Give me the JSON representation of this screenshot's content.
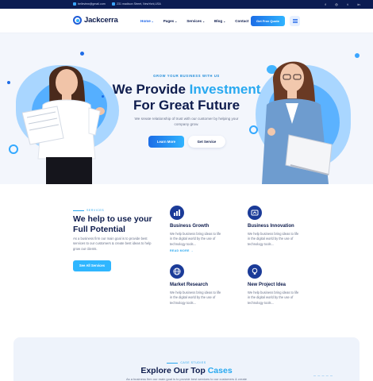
{
  "topbar": {
    "email": "belleview@gmail.com",
    "address": "231 madison Street, NewYork,USA",
    "socials": [
      "f",
      "◎",
      "t",
      "in"
    ],
    "social_icons": [
      "facebook-icon",
      "instagram-icon",
      "twitter-icon",
      "linkedin-icon"
    ]
  },
  "header": {
    "brand": "Jackcerra",
    "nav": [
      {
        "label": "Home",
        "caret": "⌄"
      },
      {
        "label": "Pages",
        "caret": "⌄"
      },
      {
        "label": "Services",
        "caret": "⌄"
      },
      {
        "label": "Blog",
        "caret": "⌄"
      },
      {
        "label": "Contact",
        "caret": ""
      }
    ],
    "cta": "Get Free Quote"
  },
  "hero": {
    "eyebrow": "GROW YOUR BUSINESS WITH US",
    "title_line1_prefix": "We Provide ",
    "title_line1_highlight": "Investment",
    "title_line2": "For Great Future",
    "subtitle": "We sreate relationship of trust with our customer by helping your company grow.",
    "learn_more": "Learn More",
    "get_service": "Get Service"
  },
  "services": {
    "eyebrow": "SERVICES",
    "title_line1": "We help to use your",
    "title_line2": "Full Potential",
    "description": "As a business firm our main goal is to provide best services to our customers & create best ideas to help grow our clients.",
    "button": "See All Services",
    "cards": [
      {
        "title": "Business Growth",
        "desc": "We help business bring ideas to life in the digital world by the use of technology tools...",
        "read_more": "READ MORE →",
        "icon": "chart-icon"
      },
      {
        "title": "Business Innovation",
        "desc": "We help business bring ideas to life in the digital world by the use of technology tools...",
        "read_more": "",
        "icon": "innovation-icon"
      },
      {
        "title": "Market Research",
        "desc": "We help business bring ideas to life in the digital world by the use of technology tools...",
        "read_more": "",
        "icon": "globe-icon"
      },
      {
        "title": "New Project Idea",
        "desc": "We help business bring ideas to life in the digital world by the use of technology tools...",
        "read_more": "",
        "icon": "idea-icon"
      }
    ]
  },
  "cases": {
    "eyebrow": "CASE STUDIES",
    "title_prefix": "Explore Our Top ",
    "title_highlight": "Cases",
    "description": "As a business firm our main goal is to provide best services to our customers & create"
  },
  "colors": {
    "navy": "#0e1c4d",
    "accent": "#28a9f0",
    "primary": "#1c64e8",
    "topbar": "#0b1c52"
  }
}
